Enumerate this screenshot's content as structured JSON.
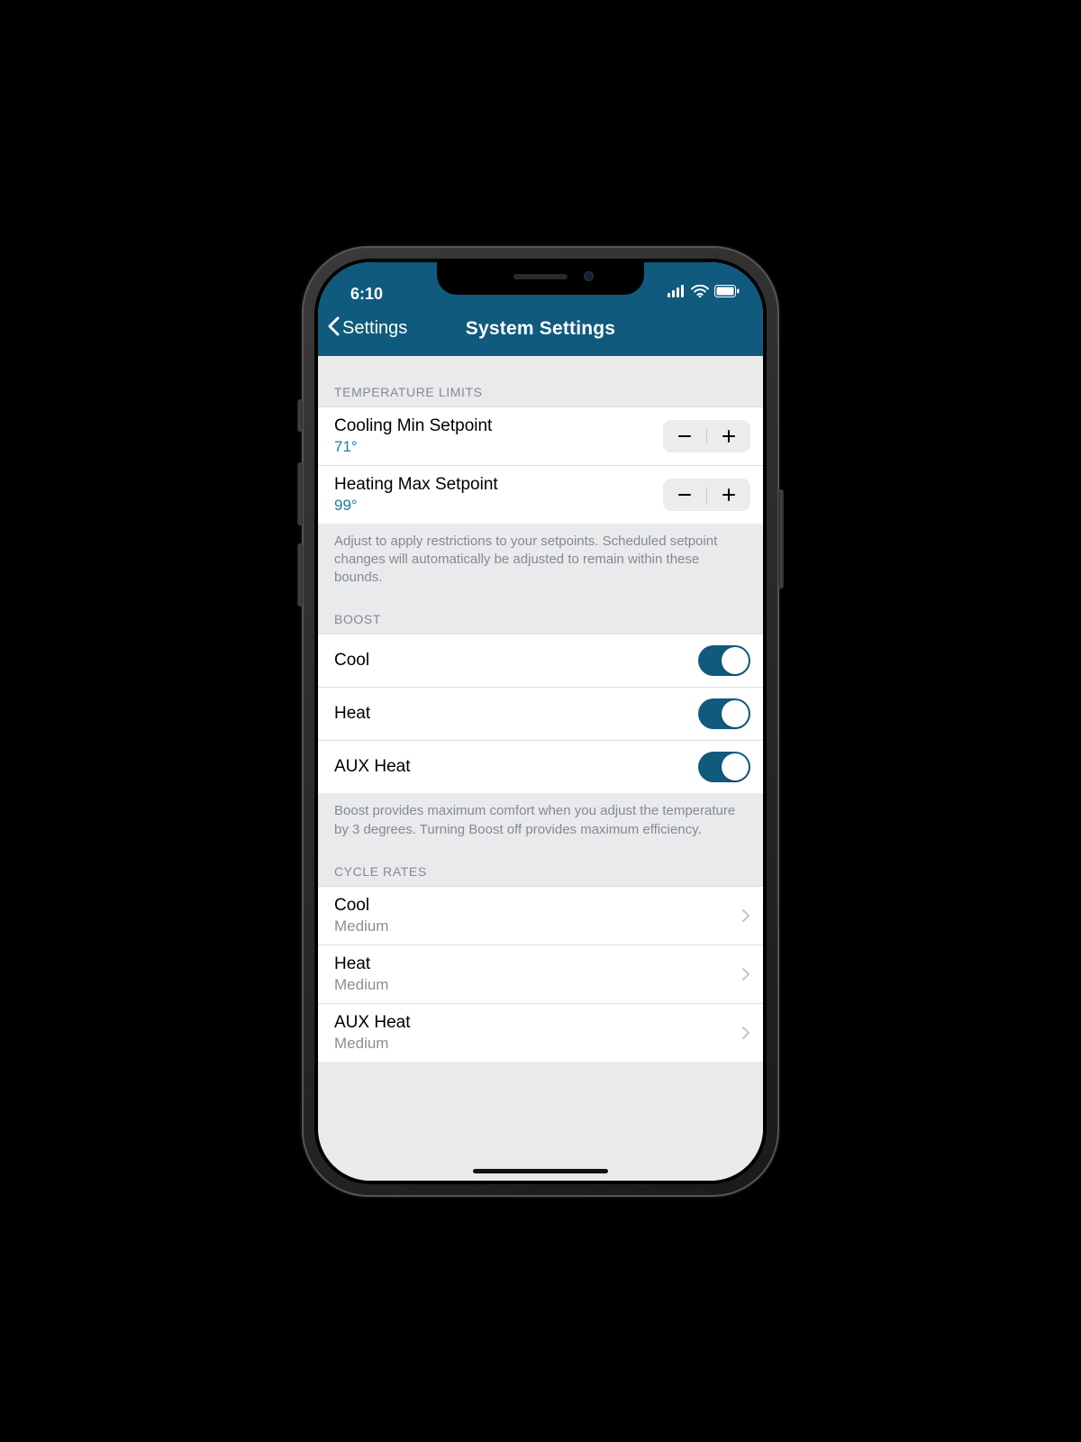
{
  "status": {
    "time": "6:10"
  },
  "nav": {
    "back_label": "Settings",
    "title": "System Settings"
  },
  "sections": {
    "temperature_limits": {
      "header": "TEMPERATURE LIMITS",
      "cooling": {
        "label": "Cooling Min Setpoint",
        "value": "71°"
      },
      "heating": {
        "label": "Heating Max Setpoint",
        "value": "99°"
      },
      "footer": "Adjust to apply restrictions to your setpoints. Scheduled setpoint changes will automatically be adjusted to remain within these bounds."
    },
    "boost": {
      "header": "BOOST",
      "cool": {
        "label": "Cool",
        "on": true
      },
      "heat": {
        "label": "Heat",
        "on": true
      },
      "aux_heat": {
        "label": "AUX Heat",
        "on": true
      },
      "footer": "Boost provides maximum comfort when you adjust the temperature by 3 degrees. Turning Boost off provides maximum efficiency."
    },
    "cycle_rates": {
      "header": "CYCLE RATES",
      "cool": {
        "label": "Cool",
        "value": "Medium"
      },
      "heat": {
        "label": "Heat",
        "value": "Medium"
      },
      "aux_heat": {
        "label": "AUX Heat",
        "value": "Medium"
      }
    }
  },
  "colors": {
    "brand": "#0f5a7d",
    "accent_text": "#1d7ea6",
    "bg": "#e9eaec"
  }
}
